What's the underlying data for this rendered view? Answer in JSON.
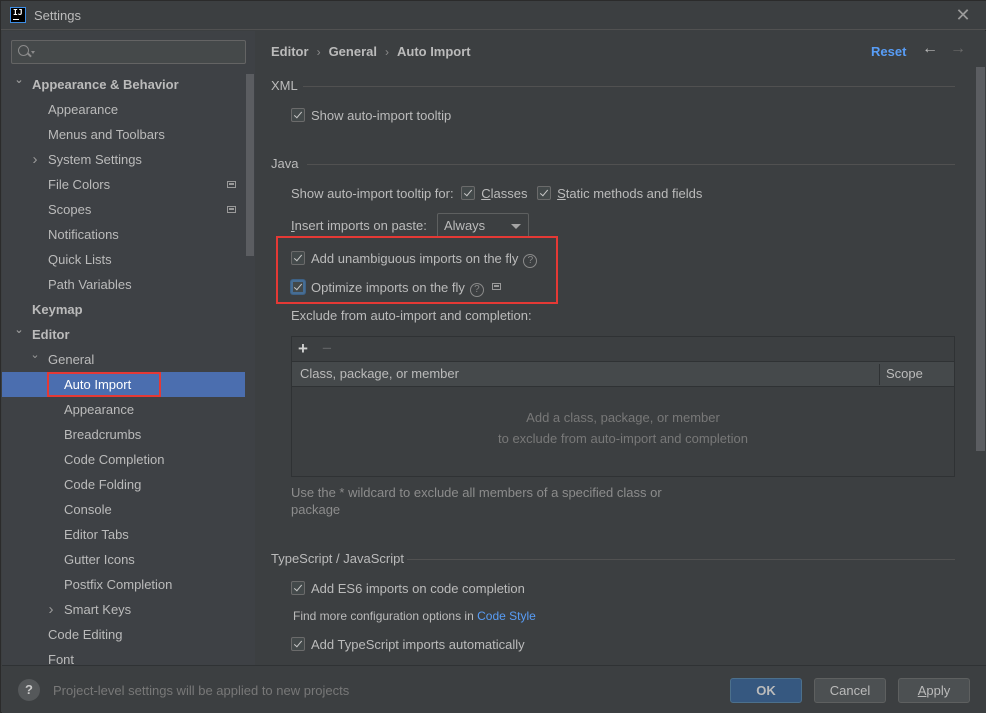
{
  "window": {
    "title": "Settings",
    "app_icon_text": "IJ"
  },
  "search": {
    "placeholder": "",
    "value": ""
  },
  "sidebar": {
    "items": [
      {
        "label": "Appearance & Behavior",
        "level": 0,
        "bold": true,
        "expanded": true
      },
      {
        "label": "Appearance",
        "level": 1
      },
      {
        "label": "Menus and Toolbars",
        "level": 1
      },
      {
        "label": "System Settings",
        "level": 1,
        "collapsed": true
      },
      {
        "label": "File Colors",
        "level": 1,
        "project_icon": true
      },
      {
        "label": "Scopes",
        "level": 1,
        "project_icon": true
      },
      {
        "label": "Notifications",
        "level": 1
      },
      {
        "label": "Quick Lists",
        "level": 1
      },
      {
        "label": "Path Variables",
        "level": 1
      },
      {
        "label": "Keymap",
        "level": 0,
        "bold": true
      },
      {
        "label": "Editor",
        "level": 0,
        "bold": true,
        "expanded": true
      },
      {
        "label": "General",
        "level": 1,
        "expanded": true
      },
      {
        "label": "Auto Import",
        "level": 2,
        "selected": true
      },
      {
        "label": "Appearance",
        "level": 2
      },
      {
        "label": "Breadcrumbs",
        "level": 2
      },
      {
        "label": "Code Completion",
        "level": 2
      },
      {
        "label": "Code Folding",
        "level": 2
      },
      {
        "label": "Console",
        "level": 2
      },
      {
        "label": "Editor Tabs",
        "level": 2
      },
      {
        "label": "Gutter Icons",
        "level": 2
      },
      {
        "label": "Postfix Completion",
        "level": 2
      },
      {
        "label": "Smart Keys",
        "level": 2,
        "collapsed": true
      },
      {
        "label": "Code Editing",
        "level": 1
      },
      {
        "label": "Font",
        "level": 1
      }
    ]
  },
  "breadcrumb": {
    "items": [
      "Editor",
      "General",
      "Auto Import"
    ],
    "separator": "›"
  },
  "header": {
    "reset_label": "Reset",
    "back_icon": "←",
    "forward_icon": "→"
  },
  "xml": {
    "title": "XML",
    "show_tooltip": {
      "label": "Show auto-import tooltip",
      "checked": true
    }
  },
  "java": {
    "title": "Java",
    "tooltip_for_label": "Show auto-import tooltip for:",
    "classes": {
      "label": "Classes",
      "mnemonic": "C",
      "rest": "lasses",
      "checked": true
    },
    "static": {
      "label": "Static methods and fields",
      "mnemonic": "S",
      "rest": "tatic methods and fields",
      "checked": true
    },
    "insert_label": "Insert imports on paste:",
    "insert_mnemonic": "I",
    "insert_rest": "nsert imports on paste:",
    "insert_value": "Always",
    "add_unambiguous": {
      "label": "Add unambiguous imports on the fly",
      "checked": true
    },
    "optimize": {
      "label": "Optimize imports on the fly",
      "checked": true
    },
    "exclude_label": "Exclude from auto-import and completion:",
    "table": {
      "add_icon": "+",
      "remove_icon": "−",
      "columns": [
        "Class, package, or member",
        "Scope"
      ],
      "rows": [],
      "empty_line1": "Add a class, package, or member",
      "empty_line2": "to exclude from auto-import and completion"
    },
    "hint": "Use the * wildcard to exclude all members of a specified class or package"
  },
  "typescript": {
    "title": "TypeScript / JavaScript",
    "es6": {
      "label": "Add ES6 imports on code completion",
      "checked": true
    },
    "more_config_prefix": "Find more configuration options in ",
    "more_config_link": "Code Style",
    "ts_auto": {
      "label": "Add TypeScript imports automatically",
      "checked": true
    }
  },
  "footer": {
    "help_icon": "?",
    "info_text": "Project-level settings will be applied to new projects",
    "ok_label": "OK",
    "cancel_label": "Cancel",
    "apply_label": "Apply",
    "apply_mnemonic": "A",
    "apply_rest": "pply"
  },
  "colors": {
    "accent": "#4b6eaf",
    "link": "#589df6",
    "highlight_border": "#e53935",
    "background": "#3c3f41",
    "sidebar_background": "#3e4145"
  }
}
